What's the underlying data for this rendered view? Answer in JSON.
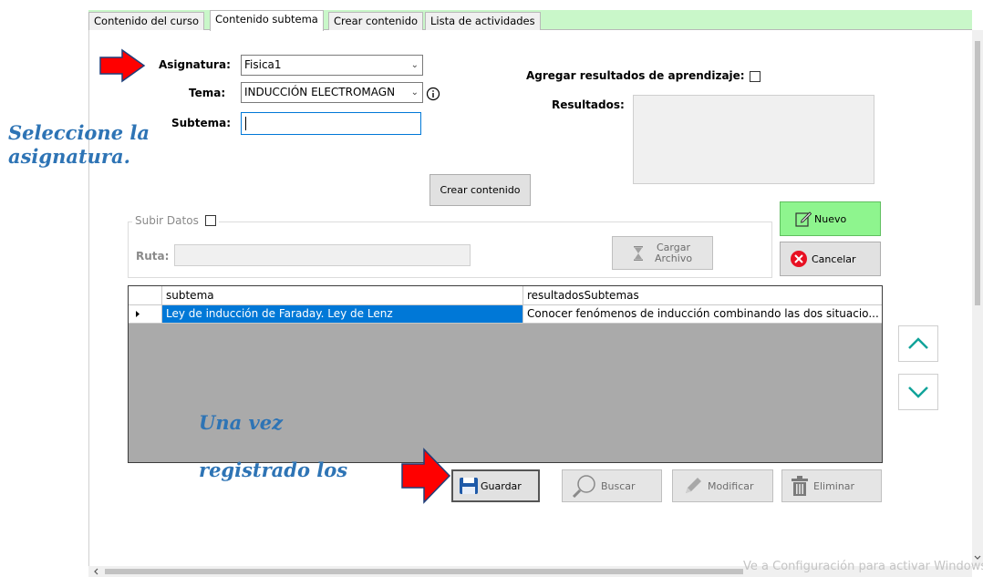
{
  "tabs": [
    "Contenido del curso",
    "Contenido subtema",
    "Crear contenido",
    "Lista de actividades"
  ],
  "form": {
    "asignatura_label": "Asignatura:",
    "asignatura_value": "Fisica1",
    "tema_label": "Tema:",
    "tema_value": "INDUCCIÓN ELECTROMAGN",
    "subtema_label": "Subtema:",
    "subtema_value": "",
    "agregar_label": "Agregar resultados de aprendizaje:",
    "resultados_label": "Resultados:",
    "crear_contenido_button": "Crear contenido",
    "subir_datos_label": "Subir Datos",
    "ruta_label": "Ruta:",
    "cargar_archivo_line1": "Cargar",
    "cargar_archivo_line2": "Archivo",
    "nuevo_button": "Nuevo",
    "cancelar_button": "Cancelar"
  },
  "grid": {
    "columns": [
      "subtema",
      "resultadosSubtemas"
    ],
    "rows": [
      [
        "Ley de inducción de Faraday. Ley de Lenz",
        "Conocer fenómenos de inducción combinando las dos situacio..."
      ]
    ]
  },
  "actions": {
    "guardar": "Guardar",
    "buscar": "Buscar",
    "modificar": "Modificar",
    "eliminar": "Eliminar"
  },
  "annotations": {
    "select_line1": "Seleccione la",
    "select_line2": "asignatura.",
    "registered_line1": "Una vez",
    "registered_line2": "registrado los"
  },
  "watermark": "Ve a Configuración para activar Windows",
  "colors": {
    "tabbar_bg": "#c9f7c9",
    "nuevo_bg": "#8ef58e",
    "selected_row": "#0078d7",
    "annotation_text": "#2e74b5",
    "arrow_red": "#ff0000",
    "arrow_icon_teal": "#11a39a"
  },
  "icons": [
    "arrow-right-icon",
    "info-icon",
    "hourglass-icon",
    "edit-icon",
    "cancel-icon",
    "save-icon",
    "search-icon",
    "pencil-icon",
    "trash-icon",
    "chevron-up-icon",
    "chevron-down-icon"
  ]
}
